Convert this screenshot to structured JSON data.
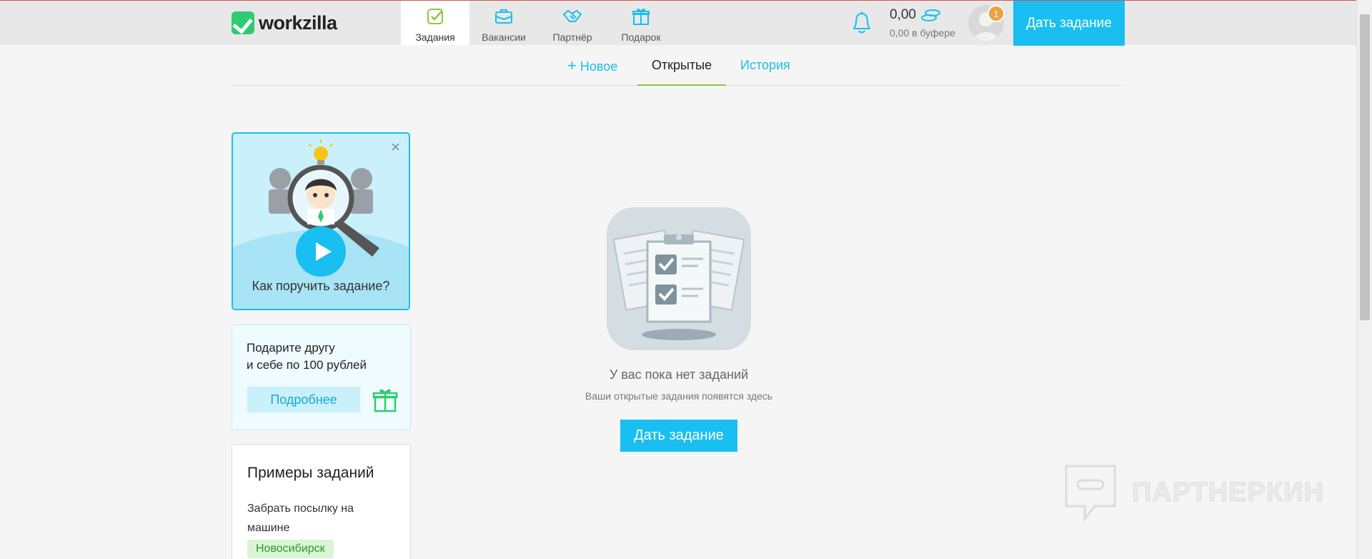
{
  "header": {
    "logo": "workzilla",
    "nav": [
      {
        "label": "Задания",
        "icon": "tasks-icon",
        "active": true
      },
      {
        "label": "Вакансии",
        "icon": "briefcase-icon",
        "active": false
      },
      {
        "label": "Партнёр",
        "icon": "handshake-icon",
        "active": false
      },
      {
        "label": "Подарок",
        "icon": "gift-icon",
        "active": false
      }
    ],
    "balance": "0,00",
    "buffer": "0,00 в буфере",
    "notification_count": "1",
    "give_task_label": "Дать задание"
  },
  "subtabs": {
    "new": "Новое",
    "open": "Открытые",
    "history": "История"
  },
  "sidebar": {
    "promo_video": {
      "caption": "Как поручить задание?",
      "close": "×"
    },
    "gift": {
      "line1": "Подарите другу",
      "line2": "и себе по 100 рублей",
      "button": "Подробнее"
    },
    "examples": {
      "title": "Примеры заданий",
      "item": "Забрать посылку на машине",
      "city": "Новосибирск"
    }
  },
  "main": {
    "empty_title": "У вас пока нет заданий",
    "empty_subtitle": "Ваши открытые задания появятся здесь",
    "give_task_label": "Дать задание"
  },
  "watermark": "ПАРТНЕРКИН",
  "colors": {
    "accent": "#19bff0",
    "logo_green": "#2ecc71",
    "tab_underline": "#8cc640",
    "badge": "#f0a040"
  }
}
